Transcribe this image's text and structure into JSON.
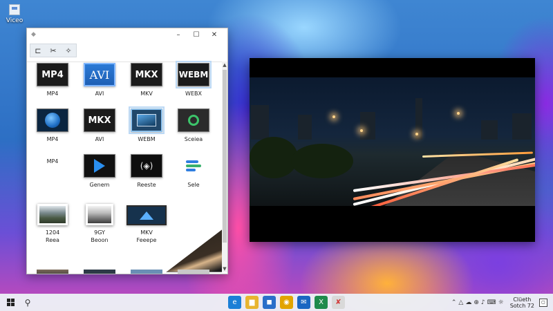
{
  "desktop": {
    "icon_label": "Viceo"
  },
  "window": {
    "titlebar_icon": "app-icon",
    "controls": [
      "–",
      "☐",
      "✕"
    ],
    "toolbar": [
      {
        "icon": "crop-icon",
        "glyph": "⊏"
      },
      {
        "icon": "cut-icon",
        "glyph": "✂"
      },
      {
        "icon": "magic-icon",
        "glyph": "✧"
      }
    ],
    "items": [
      {
        "thumb_text": "MP4",
        "caption": "MP4"
      },
      {
        "thumb_text": "AVI",
        "caption": "AVI"
      },
      {
        "thumb_text": "MKX",
        "caption": "MKV"
      },
      {
        "thumb_text": "WEBM",
        "caption": "WEBX"
      },
      {
        "thumb_text": "",
        "caption": "MP4"
      },
      {
        "thumb_text": "MKX",
        "caption": "AVI"
      },
      {
        "thumb_text": "",
        "caption": "WEBM"
      },
      {
        "thumb_text": "",
        "caption": "Sceiea"
      },
      {
        "thumb_text": "",
        "caption": "MP4"
      },
      {
        "thumb_text": "",
        "caption": "Genem"
      },
      {
        "thumb_text": "(◈)",
        "caption": "Reeste"
      },
      {
        "thumb_text": "",
        "caption": "Sele"
      },
      {
        "thumb_text": "",
        "caption": "1204\nReea"
      },
      {
        "thumb_text": "",
        "caption": "9GY\nBeoon"
      },
      {
        "thumb_text": "",
        "caption": "MKV\nFeeepe"
      }
    ]
  },
  "taskbar": {
    "apps": [
      {
        "name": "edge-icon",
        "color": "#1b7fd6",
        "glyph": "e"
      },
      {
        "name": "folder-icon",
        "color": "#e8b530",
        "glyph": "▆"
      },
      {
        "name": "store-icon",
        "color": "#2a6fc9",
        "glyph": "◼"
      },
      {
        "name": "chrome-icon",
        "color": "#e2a400",
        "glyph": "◉"
      },
      {
        "name": "mail-icon",
        "color": "#1a66c2",
        "glyph": "✉"
      },
      {
        "name": "excel-icon",
        "color": "#1f8a4c",
        "glyph": "X"
      },
      {
        "name": "video-editor-icon",
        "color": "#d9d9d9",
        "glyph": "✘"
      }
    ],
    "tray": [
      "⌃",
      "△",
      "☁",
      "⊕",
      "♪",
      "⌨",
      "☼"
    ],
    "clock_line1": "Clüeth",
    "clock_line2": "Sotch 72"
  }
}
